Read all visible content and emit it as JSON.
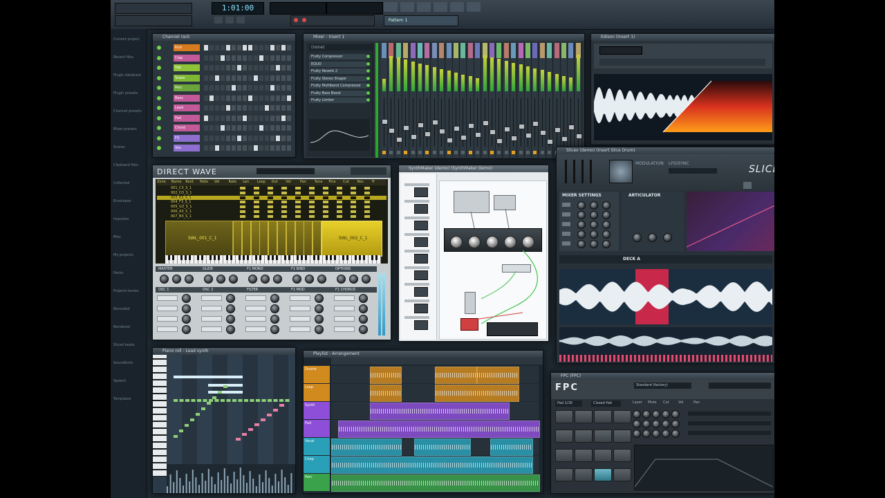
{
  "transport": {
    "time": "1:01:00",
    "pattern": "Pattern 1"
  },
  "browser": {
    "items": [
      "Current project",
      "Recent files",
      "Plugin database",
      "Plugin presets",
      "Channel presets",
      "Mixer presets",
      "Scores",
      "Clipboard files",
      "Collected",
      "Envelopes",
      "Impulses",
      "Misc",
      "My projects",
      "Packs",
      "Projects bones",
      "Recorded",
      "Rendered",
      "Sliced beats",
      "Soundfonts",
      "Speech",
      "Templates"
    ]
  },
  "channel_rack": {
    "title": "Channel rack",
    "channels": [
      {
        "name": "Kick",
        "color": "#d87a1e"
      },
      {
        "name": "Clap",
        "color": "#c25a9a"
      },
      {
        "name": "Hat",
        "color": "#8fc43a"
      },
      {
        "name": "Snare",
        "color": "#7fb835"
      },
      {
        "name": "Perc",
        "color": "#6aa43a"
      },
      {
        "name": "Bass",
        "color": "#c25a9a"
      },
      {
        "name": "Lead",
        "color": "#c25a9a"
      },
      {
        "name": "Pad",
        "color": "#c25a9a"
      },
      {
        "name": "Chord",
        "color": "#c25a9a"
      },
      {
        "name": "FX",
        "color": "#8e6fd0"
      },
      {
        "name": "Vox",
        "color": "#8e6fd0"
      }
    ]
  },
  "mixer": {
    "title": "Mixer - Insert 1",
    "preset": "(none)",
    "effects": [
      "Fruity Compressor",
      "EQUO",
      "Fruity Reverb 2",
      "Fruity Stereo Shaper",
      "Fruity Multiband Compressor",
      "Fruity Bass Boost",
      "Fruity Limiter"
    ],
    "track_colors": [
      "#6a8fb8",
      "#b86a6a",
      "#6ab88f",
      "#b8a86a",
      "#8f6ab8",
      "#6ab8b8",
      "#b86aa4",
      "#7a8fb8",
      "#b8866a",
      "#6a8fb8",
      "#a4b86a",
      "#6ab89a",
      "#b86a8a",
      "#6a7ab8",
      "#b8b86a",
      "#8a6ab8",
      "#6ab86a",
      "#b87a6a",
      "#6a9ab8",
      "#b86ab8",
      "#7ab86a",
      "#6a6ab8",
      "#b89a6a",
      "#6ab8a4",
      "#b86a7a",
      "#8ab86a",
      "#6a8ab8",
      "#b8a46a"
    ]
  },
  "edison": {
    "title": "Edison (Insert 1)"
  },
  "direct_wave": {
    "logo": "DIRECT WAVE",
    "columns": [
      "Zone",
      "Name",
      "Root",
      "Note",
      "Vel",
      "Rate",
      "Len",
      "Loop",
      "Out",
      "Vol",
      "Pan",
      "Tune",
      "Fine",
      "Cut",
      "Res",
      "Tr"
    ],
    "rows": [
      "001_C3_S_1",
      "002_D3_S_1",
      "003_E3_S_1",
      "004_F3_S_1",
      "005_G3_S_1",
      "006_A3_S_1",
      "007_B3_S_1"
    ],
    "zone_left": "SWL_001_C_1",
    "zone_right": "SWL_002_C_1",
    "sections": [
      "MASTER",
      "GLIDE",
      "F1 MONO",
      "F1 BIND",
      "OPTIONS"
    ],
    "sub_sections": [
      "OSC 1",
      "OSC 2",
      "FILTER",
      "F1 MOD",
      "F1 CHORUS"
    ]
  },
  "synthmaker": {
    "title": "SynthMaker (demo) (SynthMaker Demo)"
  },
  "slicex": {
    "title": "Slicex (demo) (Insert Slice Drum)",
    "logo": "SLICEX",
    "sections": [
      "MODULATION",
      "LFO/SYNC"
    ],
    "mixer_settings": "MIXER SETTINGS",
    "articulator": "ARTICULATOR",
    "deck": "DECK A"
  },
  "piano_roll": {
    "title": "Piano roll - Lead synth"
  },
  "playlist": {
    "title": "Playlist - Arrangement",
    "tracks": [
      {
        "name": "Drums",
        "color": "#d18a1e"
      },
      {
        "name": "Loop",
        "color": "#d18a1e"
      },
      {
        "name": "Synth",
        "color": "#8e4fd8"
      },
      {
        "name": "Pad",
        "color": "#8e4fd8"
      },
      {
        "name": "Vocal",
        "color": "#2aa0b8"
      },
      {
        "name": "Chop",
        "color": "#2aa0b8"
      },
      {
        "name": "Perc",
        "color": "#3aa24a"
      }
    ]
  },
  "fpc": {
    "title": "FPC (FPC)",
    "logo": "FPC",
    "kit": "Standard (factory)",
    "pad_label": "Pad 1/16",
    "note": "Closed Hat",
    "layer_options": [
      "Layer",
      "Mute",
      "Cut",
      "Vol",
      "Pan"
    ]
  },
  "colors": {
    "accent_cyan": "#8fe0ff",
    "accent_orange": "#e68a1e",
    "accent_pink": "#e04a7a",
    "panel": "#2a353e"
  }
}
